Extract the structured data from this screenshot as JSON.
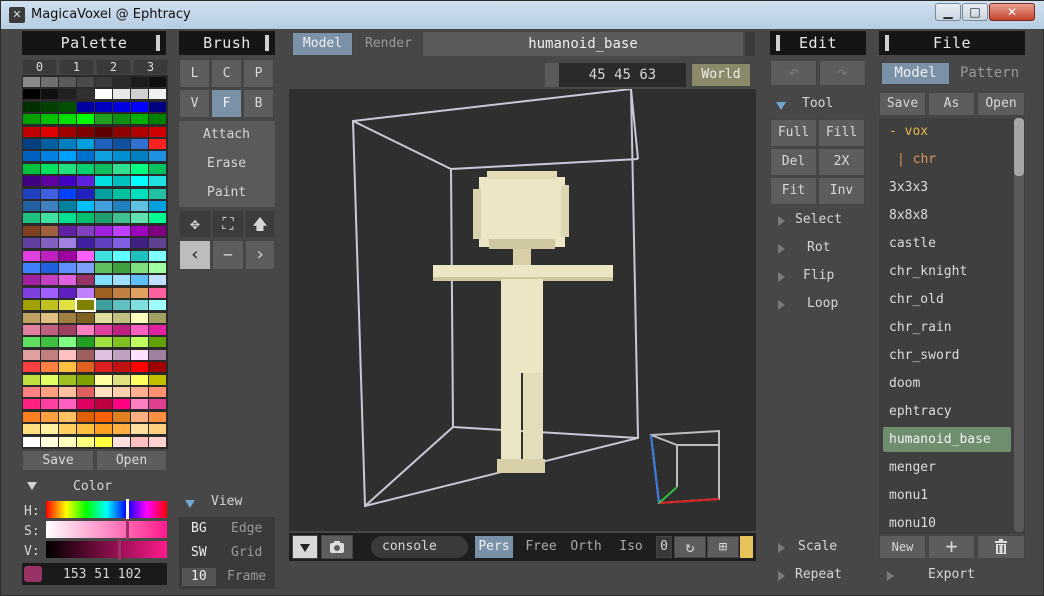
{
  "window": {
    "title": "MagicaVoxel @ Ephtracy",
    "minimize": "▁",
    "maximize": "□",
    "close": "✕"
  },
  "palette": {
    "title": "Palette",
    "tabs": [
      "0",
      "1",
      "2",
      "3"
    ],
    "save": "Save",
    "open": "Open",
    "colors": [
      [
        "#8a8a8a",
        "#707070",
        "#5a5a5a",
        "#4a4a4a",
        "#3a3a3a",
        "#2a2a2a",
        "#1c1c1c",
        "#101010"
      ],
      [
        "#000000",
        "#101010",
        "#202020",
        "#303030",
        "#ffffff",
        "#e8e8e8",
        "#d0d0d0",
        "#f0f0f0"
      ],
      [
        "#003000",
        "#004000",
        "#005000",
        "#0000a0",
        "#0000c0",
        "#0000e0",
        "#0000ff",
        "#000080"
      ],
      [
        "#00a000",
        "#00c000",
        "#00e000",
        "#00ff00",
        "#20a020",
        "#109010",
        "#00b000",
        "#008000"
      ],
      [
        "#c00000",
        "#e00000",
        "#a00000",
        "#800000",
        "#600000",
        "#900000",
        "#b00000",
        "#d00000"
      ],
      [
        "#004080",
        "#0060a0",
        "#0080c0",
        "#00a0e0",
        "#2060c0",
        "#1050a0",
        "#3070d0",
        "#ff2020"
      ],
      [
        "#0060c0",
        "#0080e0",
        "#00a0ff",
        "#0070d0",
        "#10a0e0",
        "#0090d0",
        "#0080c0",
        "#2090e0"
      ],
      [
        "#00c040",
        "#00e060",
        "#20e080",
        "#00d070",
        "#10c060",
        "#30e090",
        "#00ff80",
        "#00c060"
      ],
      [
        "#400080",
        "#6000a0",
        "#4000c0",
        "#6020e0",
        "#00e0e0",
        "#00c0c0",
        "#00ffff",
        "#20e0e0"
      ],
      [
        "#2040c0",
        "#4060e0",
        "#0040ff",
        "#2020c0",
        "#00a0a0",
        "#00c0a0",
        "#00e0c0",
        "#20c0a0"
      ],
      [
        "#2060a0",
        "#4080c0",
        "#0080a0",
        "#00c0ff",
        "#40a0e0",
        "#2080c0",
        "#60c0e0",
        "#00a0e0"
      ],
      [
        "#20c080",
        "#40e0a0",
        "#00e090",
        "#00c070",
        "#20a070",
        "#40c090",
        "#60e0b0",
        "#00ff90"
      ],
      [
        "#804020",
        "#a06040",
        "#6020a0",
        "#8040c0",
        "#a020e0",
        "#c040ff",
        "#a000c0",
        "#800080"
      ],
      [
        "#6040a0",
        "#8060c0",
        "#a080e0",
        "#4020a0",
        "#6040c0",
        "#8060e0",
        "#402080",
        "#604090"
      ],
      [
        "#e040e0",
        "#c020c0",
        "#a000a0",
        "#ff60ff",
        "#40e0e0",
        "#60ffff",
        "#20c0c0",
        "#80ffff"
      ],
      [
        "#4080ff",
        "#2060e0",
        "#6090ff",
        "#80a0ff",
        "#60c060",
        "#40a040",
        "#80e080",
        "#a0ffa0"
      ],
      [
        "#a020a0",
        "#c040c0",
        "#e060e0",
        "#993366",
        "#80e0ff",
        "#a0e0ff",
        "#60c0ff",
        "#c0e0ff"
      ],
      [
        "#8040e0",
        "#a060ff",
        "#6020c0",
        "#c080ff",
        "#a06020",
        "#c08040",
        "#e0a060",
        "#ff60a0"
      ],
      [
        "#a0a000",
        "#c0c020",
        "#e0e040",
        "#808000",
        "#40a0a0",
        "#60c0c0",
        "#80e0e0",
        "#a0ffff"
      ],
      [
        "#c0a060",
        "#e0c080",
        "#a08040",
        "#806020",
        "#e0e0a0",
        "#c0c080",
        "#ffffc0",
        "#a0a060"
      ],
      [
        "#e080a0",
        "#c06080",
        "#a04060",
        "#ff80c0",
        "#e040a0",
        "#c02080",
        "#ff60c0",
        "#e020a0"
      ],
      [
        "#60e060",
        "#40c040",
        "#80ff80",
        "#20a020",
        "#a0e040",
        "#80c020",
        "#c0ff60",
        "#60a000"
      ],
      [
        "#e0a0a0",
        "#c08080",
        "#ffc0c0",
        "#a06060",
        "#e0c0e0",
        "#c0a0c0",
        "#ffe0ff",
        "#a080a0"
      ],
      [
        "#ff4040",
        "#ff8040",
        "#ffc040",
        "#e06020",
        "#e02020",
        "#c01010",
        "#ff0000",
        "#a00000"
      ],
      [
        "#c0e040",
        "#e0ff60",
        "#a0c020",
        "#80a000",
        "#ffffa0",
        "#e0e080",
        "#ffff60",
        "#c0c000"
      ],
      [
        "#ff8080",
        "#ffa080",
        "#ffc0a0",
        "#e06060",
        "#ffe0c0",
        "#ffd0b0",
        "#ffb090",
        "#ff9070"
      ],
      [
        "#ff2080",
        "#ff40a0",
        "#ff60c0",
        "#e00060",
        "#c00040",
        "#ff0080",
        "#ff80c0",
        "#e04090"
      ],
      [
        "#ff8020",
        "#ffa040",
        "#ffc060",
        "#e06000",
        "#ff6000",
        "#e08020",
        "#ffb080",
        "#ff9040"
      ],
      [
        "#ffe080",
        "#fff0a0",
        "#ffd060",
        "#ffc040",
        "#ffa020",
        "#ffb040",
        "#ffe0a0",
        "#ffd080"
      ],
      [
        "#ffffff",
        "#ffffe0",
        "#ffffc0",
        "#ffff80",
        "#ffff40",
        "#ffe0e0",
        "#ffc0c0",
        "#ffd0d0"
      ]
    ],
    "selected_row": 18,
    "selected_col": 3
  },
  "color": {
    "title": "Color",
    "h_label": "H:",
    "s_label": "S:",
    "v_label": "V:",
    "value": "153 51 102",
    "swatch": "#993366"
  },
  "brush": {
    "title": "Brush",
    "mode_buttons": [
      "L",
      "C",
      "P",
      "V",
      "F",
      "B"
    ],
    "active_mode": "F",
    "actions": [
      "Attach",
      "Erase",
      "Paint"
    ],
    "icons": {
      "move": "✥",
      "select": "⛶",
      "up": "🡅",
      "left": "‹",
      "minus": "−",
      "right": "›"
    }
  },
  "view": {
    "title": "View",
    "rows": [
      {
        "key": "BG",
        "label": "Edge"
      },
      {
        "key": "SW",
        "label": "Grid"
      },
      {
        "key": "10",
        "label": "Frame"
      }
    ]
  },
  "viewport": {
    "tab_model": "Model",
    "tab_render": "Render",
    "file_name": "humanoid_base",
    "size": "45 45 63",
    "world": "World",
    "console": "console",
    "modes": [
      "Pers",
      "Free",
      "Orth",
      "Iso"
    ],
    "active_mode": "Pers",
    "counter": "0"
  },
  "edit": {
    "title": "Edit",
    "undo": "↶",
    "redo": "↷",
    "tool_section": "Tool",
    "tools": [
      "Full",
      "Fill",
      "Del",
      "2X",
      "Fit",
      "Inv"
    ],
    "sections": [
      "Select",
      "Rot",
      "Flip",
      "Loop"
    ],
    "bottom": [
      "Scale",
      "Repeat"
    ]
  },
  "file": {
    "title": "File",
    "tab_model": "Model",
    "tab_pattern": "Pattern",
    "actions": [
      "Save",
      "As",
      "Open"
    ],
    "folder": "- vox",
    "subfolder": "| chr",
    "files": [
      "3x3x3",
      "8x8x8",
      "castle",
      "chr_knight",
      "chr_old",
      "chr_rain",
      "chr_sword",
      "doom",
      "ephtracy",
      "humanoid_base",
      "menger",
      "monu1",
      "monu10"
    ],
    "selected": "humanoid_base",
    "new": "New",
    "add": "+",
    "export": "Export"
  }
}
